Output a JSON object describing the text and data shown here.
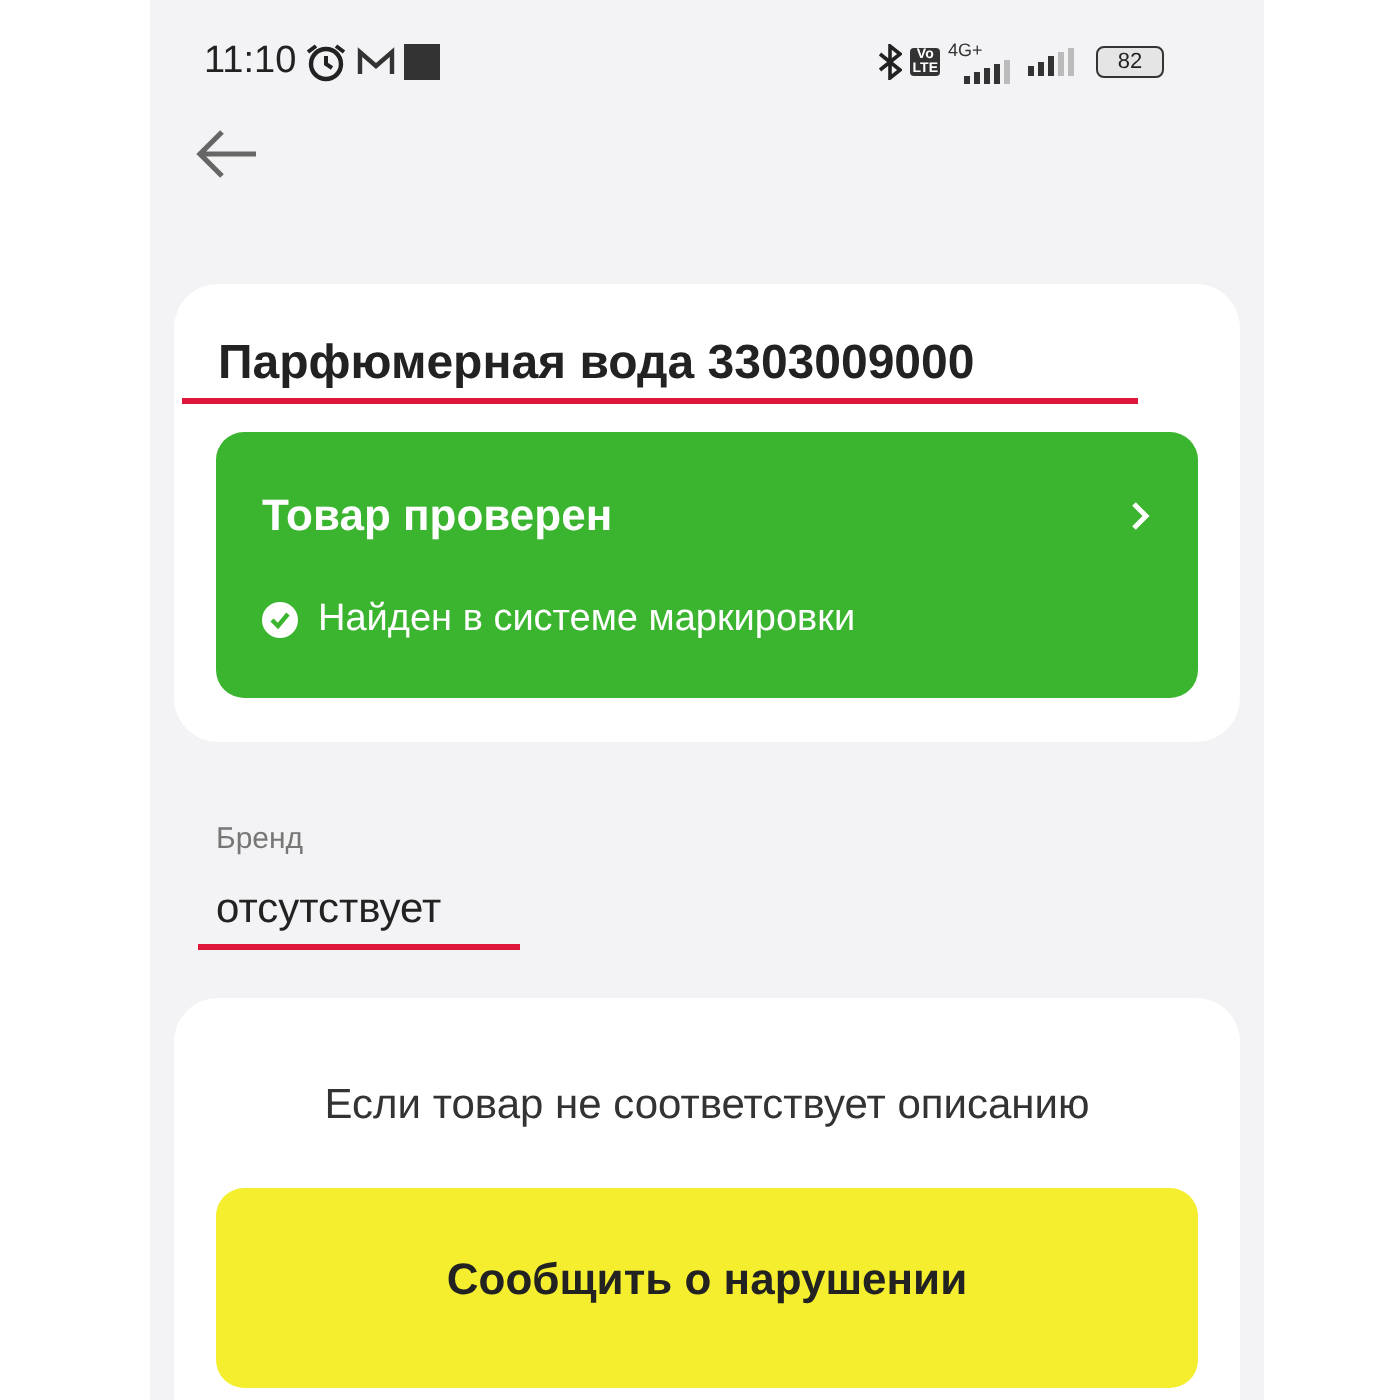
{
  "status_bar": {
    "time": "11:10",
    "volte_top": "Vo",
    "volte_bottom": "LTE",
    "network": "4G+",
    "battery": "82"
  },
  "product": {
    "title": "Парфюмерная вода 3303009000",
    "title_underlined": true,
    "check": {
      "title": "Товар проверен",
      "status": "Найден в системе маркировки",
      "verified": true
    }
  },
  "brand": {
    "label": "Бренд",
    "value": "отсутствует",
    "value_underlined": true
  },
  "report": {
    "text": "Если товар не соответствует описанию",
    "button": "Сообщить о нарушении"
  }
}
